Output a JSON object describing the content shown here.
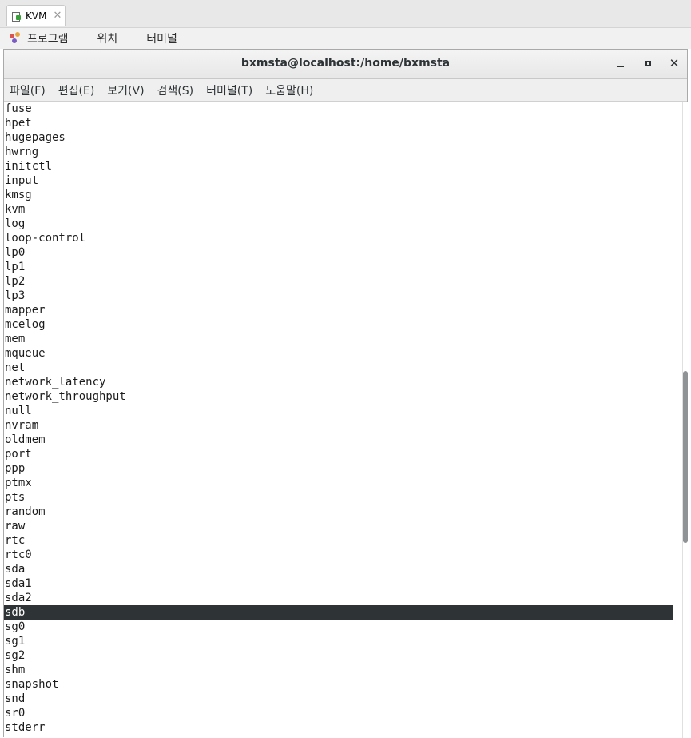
{
  "host_tab": {
    "label": "KVM",
    "close_glyph": "✕",
    "icon": "vm-window-icon"
  },
  "panel": {
    "items": [
      "프로그램",
      "위치",
      "터미널"
    ],
    "apps_icon": "gnome-foot-icon"
  },
  "window": {
    "title": "bxmsta@localhost:/home/bxmsta",
    "close_glyph": "✕"
  },
  "menubar": [
    "파일(F)",
    "편집(E)",
    "보기(V)",
    "검색(S)",
    "터미널(T)",
    "도움말(H)"
  ],
  "terminal": {
    "lines": [
      "fuse",
      "hpet",
      "hugepages",
      "hwrng",
      "initctl",
      "input",
      "kmsg",
      "kvm",
      "log",
      "loop-control",
      "lp0",
      "lp1",
      "lp2",
      "lp3",
      "mapper",
      "mcelog",
      "mem",
      "mqueue",
      "net",
      "network_latency",
      "network_throughput",
      "null",
      "nvram",
      "oldmem",
      "port",
      "ppp",
      "ptmx",
      "pts",
      "random",
      "raw",
      "rtc",
      "rtc0",
      "sda",
      "sda1",
      "sda2",
      "sdb",
      "sg0",
      "sg1",
      "sg2",
      "shm",
      "snapshot",
      "snd",
      "sr0",
      "stderr"
    ],
    "selected_line": "sdb"
  },
  "scrollbar": {
    "position_fraction": 0.58,
    "visible_fraction": 0.27
  },
  "colors": {
    "selection_bg": "#2e3436",
    "text": "#1c1c1c",
    "thumb": "#8f9396"
  }
}
